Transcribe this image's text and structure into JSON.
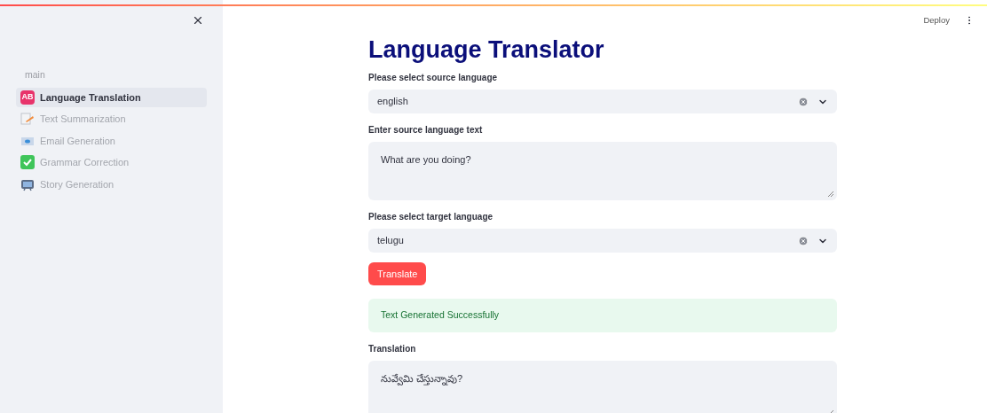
{
  "sidebar": {
    "section": "main",
    "items": [
      {
        "label": "Language Translation",
        "kind": "letters",
        "badge": "AB",
        "selected": true
      },
      {
        "label": "Text Summarization",
        "kind": "memo",
        "selected": false
      },
      {
        "label": "Email Generation",
        "kind": "envelope",
        "selected": false
      },
      {
        "label": "Grammar Correction",
        "kind": "check",
        "selected": false
      },
      {
        "label": "Story Generation",
        "kind": "tv",
        "selected": false
      }
    ]
  },
  "header": {
    "deploy": "Deploy"
  },
  "main": {
    "title": "Language Translator",
    "fields": [
      {
        "kind": "select",
        "label": "Please select source language",
        "value": "english"
      },
      {
        "kind": "textarea",
        "label": "Enter source language text",
        "value": "What are you doing?"
      },
      {
        "kind": "select",
        "label": "Please select target language",
        "value": "telugu"
      },
      {
        "kind": "button",
        "label": "Translate"
      },
      {
        "kind": "alert",
        "label": "Text Generated Successfully"
      },
      {
        "kind": "textarea",
        "label": "Translation",
        "value": "నువ్వేమి చేస్తున్నావు?"
      }
    ]
  }
}
